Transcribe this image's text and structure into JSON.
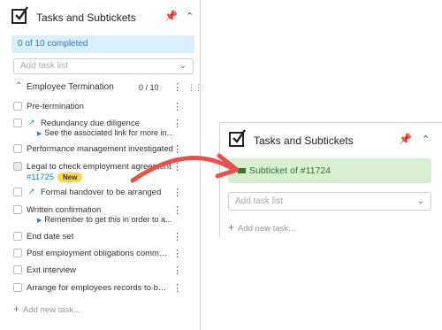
{
  "left_panel": {
    "title": "Tasks and Subtickets",
    "progress": "0 of 10 completed",
    "task_list_placeholder": "Add task list",
    "group": {
      "label": "Employee Termination",
      "count": "0 / 10"
    },
    "items": [
      {
        "label": "Pre-termination"
      },
      {
        "label": "Redundancy due diligence",
        "sub": "See the associated link for more in..."
      },
      {
        "label": "Performance management investigated"
      },
      {
        "label": "Legal to check employment agreement",
        "link": "#11725",
        "badge": "New"
      },
      {
        "label": "Formal handover to be arranged"
      },
      {
        "label": "Written confirmation",
        "sub": "Remember to get this in order to a..."
      },
      {
        "label": "End date set"
      },
      {
        "label": "Post employment obligations commu..."
      },
      {
        "label": "Exit interview"
      },
      {
        "label": "Arrange for employees records to be ..."
      }
    ],
    "add_task": "Add new task..."
  },
  "right_panel": {
    "title": "Tasks and Subtickets",
    "subticket": "Subticket of #11724",
    "task_list_placeholder": "Add task list",
    "add_task": "Add new task..."
  },
  "colors": {
    "accent": "#2a7bbf",
    "arrow": "#e4544d",
    "subticket_bg": "#d8efd2",
    "badge": "#ffd54f"
  }
}
